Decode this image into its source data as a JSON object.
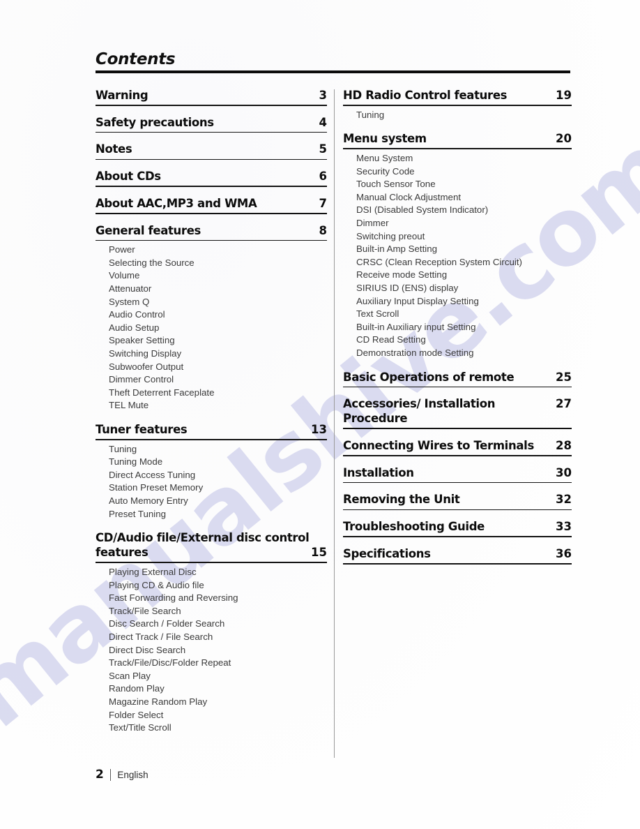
{
  "document": {
    "title": "Contents",
    "footer": {
      "page_number": "2",
      "language": "English"
    },
    "watermark": "manualshive.com",
    "watermark_color": "#b9bbe4"
  },
  "left_column": [
    {
      "title": "Warning",
      "page": "3",
      "sub": []
    },
    {
      "title": "Safety precautions",
      "page": "4",
      "sub": []
    },
    {
      "title": "Notes",
      "page": "5",
      "sub": []
    },
    {
      "title": "About CDs",
      "page": "6",
      "sub": []
    },
    {
      "title": "About AAC,MP3 and WMA",
      "page": "7",
      "sub": []
    },
    {
      "title": "General features",
      "page": "8",
      "sub": [
        "Power",
        "Selecting the Source",
        "Volume",
        "Attenuator",
        "System Q",
        "Audio Control",
        "Audio Setup",
        "Speaker Setting",
        "Switching Display",
        "Subwoofer Output",
        "Dimmer Control",
        "Theft Deterrent Faceplate",
        "TEL Mute"
      ]
    },
    {
      "title": "Tuner features",
      "page": "13",
      "sub": [
        "Tuning",
        "Tuning Mode",
        "Direct Access Tuning",
        "Station Preset Memory",
        "Auto Memory Entry",
        "Preset Tuning"
      ]
    },
    {
      "title_line1": "CD/Audio file/External disc control",
      "title_line2": "features",
      "page": "15",
      "wrap": true,
      "sub": [
        "Playing External Disc",
        "Playing CD & Audio file",
        "Fast Forwarding and Reversing",
        "Track/File Search",
        "Disc Search / Folder Search",
        "Direct Track / File Search",
        "Direct Disc Search",
        "Track/File/Disc/Folder Repeat",
        "Scan Play",
        "Random Play",
        "Magazine Random Play",
        "Folder Select",
        "Text/Title Scroll"
      ]
    }
  ],
  "right_column": [
    {
      "title": "HD Radio Control features",
      "page": "19",
      "sub": [
        "Tuning"
      ]
    },
    {
      "title": "Menu system",
      "page": "20",
      "sub": [
        "Menu System",
        "Security Code",
        "Touch Sensor Tone",
        "Manual Clock Adjustment",
        "DSI (Disabled System Indicator)",
        "Dimmer",
        "Switching preout",
        "Built-in Amp Setting",
        "CRSC (Clean Reception System Circuit)",
        "Receive mode Setting",
        "SIRIUS ID (ENS) display",
        "Auxiliary Input Display Setting",
        "Text Scroll",
        "Built-in Auxiliary input Setting",
        "CD Read Setting",
        "Demonstration mode Setting"
      ]
    },
    {
      "title": "Basic Operations of remote",
      "page": "25",
      "sub": []
    },
    {
      "title": "Accessories/ Installation Procedure",
      "page": "27",
      "sub": []
    },
    {
      "title": "Connecting Wires to Terminals",
      "page": "28",
      "sub": []
    },
    {
      "title": "Installation",
      "page": "30",
      "sub": []
    },
    {
      "title": "Removing the Unit",
      "page": "32",
      "sub": []
    },
    {
      "title": "Troubleshooting Guide",
      "page": "33",
      "sub": []
    },
    {
      "title": "Specifications",
      "page": "36",
      "sub": []
    }
  ]
}
